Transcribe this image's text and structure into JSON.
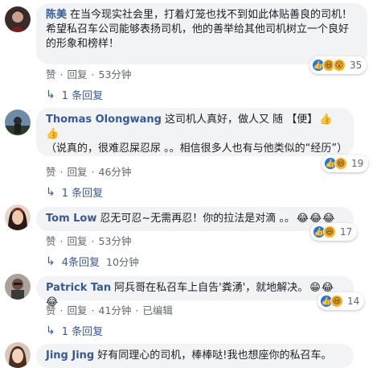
{
  "comments": [
    {
      "author": "陈美",
      "text": "在当今现实社会里，打着灯笼也找不到如此体贴善良的司机！希望私召车公司能够表扬司机，他的善举给其他司机树立一个良好的形象和榜样！",
      "emojis": "",
      "reaction_icons": [
        "like-icon",
        "haha-icon",
        "wow-icon"
      ],
      "reaction_count": "35",
      "like": "赞",
      "reply": "回复",
      "time": "53分钟",
      "edited": "",
      "replies": "1 条回复",
      "replies_time": ""
    },
    {
      "author": "Thomas Olongwang",
      "text": "这司机人真好，做人又 随 【便】",
      "text2": "（说真的，很难忍屎忍尿 。。相信很多人也有与他类似的“经历”）",
      "emojis": "👍👍",
      "reaction_icons": [
        "like-icon",
        "haha-icon"
      ],
      "reaction_count": "19",
      "like": "赞",
      "reply": "回复",
      "time": "46分钟",
      "edited": "",
      "replies": "1 条回复",
      "replies_time": ""
    },
    {
      "author": "Tom Low",
      "text": "忍无可忍~无需再忍！你的拉法是对滴 。。",
      "emojis": "😂😂😂",
      "reaction_icons": [
        "like-icon",
        "haha-icon"
      ],
      "reaction_count": "17",
      "like": "赞",
      "reply": "回复",
      "time": "53分钟",
      "edited": "",
      "replies": "4条回复",
      "replies_time": "10分钟"
    },
    {
      "author": "Patrick Tan",
      "text": "阿兵哥在私召车上自告'粪湧'，就地解决。",
      "emojis": "😁😂😂",
      "reaction_icons": [
        "like-icon",
        "haha-icon"
      ],
      "reaction_count": "14",
      "like": "赞",
      "reply": "回复",
      "time": "41分钟",
      "edited": "已编辑",
      "replies": "1 条回复",
      "replies_time": ""
    },
    {
      "author": "Jing Jing",
      "text": "好有同理心的司机，棒棒哒!我也想座你的私召车。",
      "emojis": "",
      "reaction_icons": [],
      "reaction_count": "",
      "like": "",
      "reply": "",
      "time": "",
      "edited": "",
      "replies": "",
      "replies_time": ""
    }
  ],
  "colors": {
    "author": "#385898",
    "bubble": "#f2f3f5",
    "meta": "#606770",
    "like": "#1877f2",
    "haha": "#f7b125"
  }
}
